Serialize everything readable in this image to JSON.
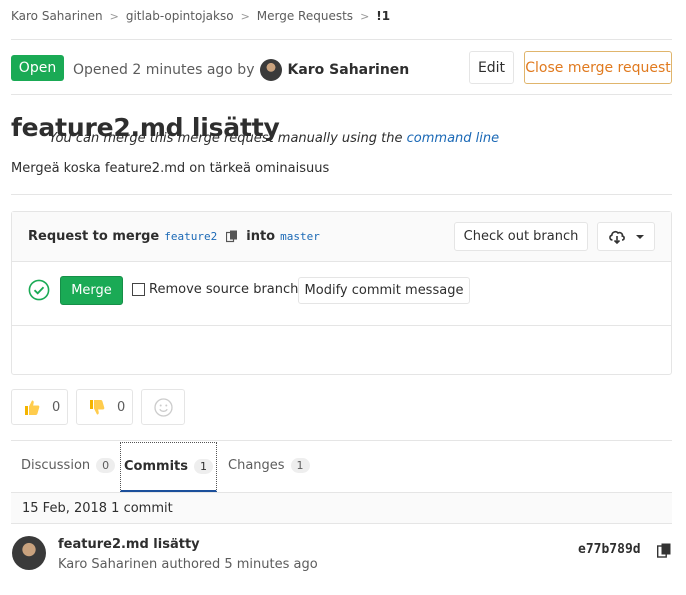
{
  "breadcrumb": {
    "items": [
      "Karo Saharinen",
      "gitlab-opintojakso",
      "Merge Requests"
    ],
    "current": "!1",
    "separator": ">"
  },
  "header": {
    "status": "Open",
    "opened_text": "Opened 2 minutes ago by",
    "author": "Karo Saharinen",
    "edit_label": "Edit",
    "close_label": "Close merge request"
  },
  "mr": {
    "title": "feature2.md lisätty",
    "description": "Mergeä koska feature2.md on tärkeä ominaisuus"
  },
  "widget": {
    "request_label": "Request to merge",
    "source_branch": "feature2",
    "into_label": "into",
    "target_branch": "master",
    "checkout_label": "Check out branch",
    "merge_label": "Merge",
    "remove_source_label": "Remove source branch",
    "modify_label": "Modify commit message",
    "manual_text": "You can merge this merge request manually using the",
    "manual_link": "command line",
    "colors": {
      "success": "#1aaa55",
      "link": "#1b69b6"
    }
  },
  "awards": {
    "thumbsup_count": "0",
    "thumbsdown_count": "0"
  },
  "tabs": [
    {
      "label": "Discussion",
      "count": "0"
    },
    {
      "label": "Commits",
      "count": "1"
    },
    {
      "label": "Changes",
      "count": "1"
    }
  ],
  "commits": {
    "day_header": "15 Feb, 2018 1 commit",
    "items": [
      {
        "title": "feature2.md lisätty",
        "meta": "Karo Saharinen authored 5 minutes ago",
        "sha": "e77b789d"
      }
    ]
  }
}
